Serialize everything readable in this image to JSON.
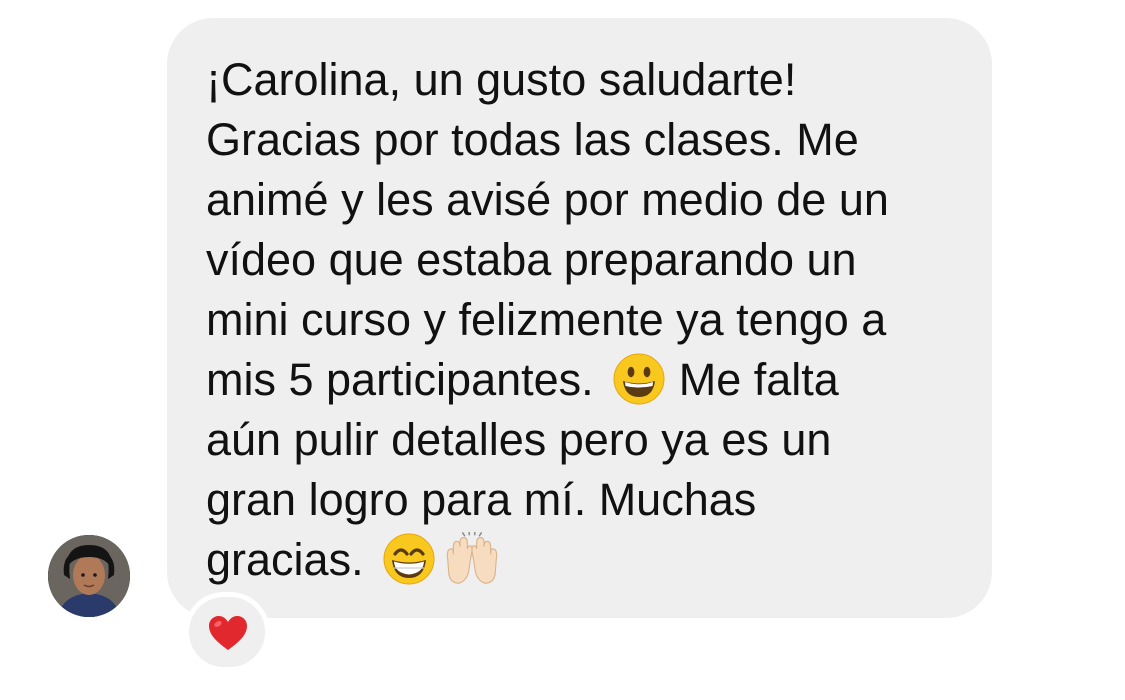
{
  "message": {
    "lines": [
      "¡Carolina, un gusto saludarte!",
      "Gracias por todas las clases. Me",
      "animé y les avisé por medio de un",
      "vídeo que estaba preparando un",
      "mini curso y felizmente ya tengo a",
      "mis 5 participantes.",
      "Me falta",
      "aún pulir detalles pero ya es un",
      "gran logro para mí. Muchas",
      "gracias."
    ],
    "emojis": [
      "grinning-face-icon",
      "beaming-face-icon",
      "raising-hands-icon"
    ]
  },
  "reaction": {
    "icon": "red-heart-icon",
    "color": "#e0282e"
  },
  "colors": {
    "bubble": "#efefef",
    "text": "#111111",
    "background": "#ffffff"
  }
}
